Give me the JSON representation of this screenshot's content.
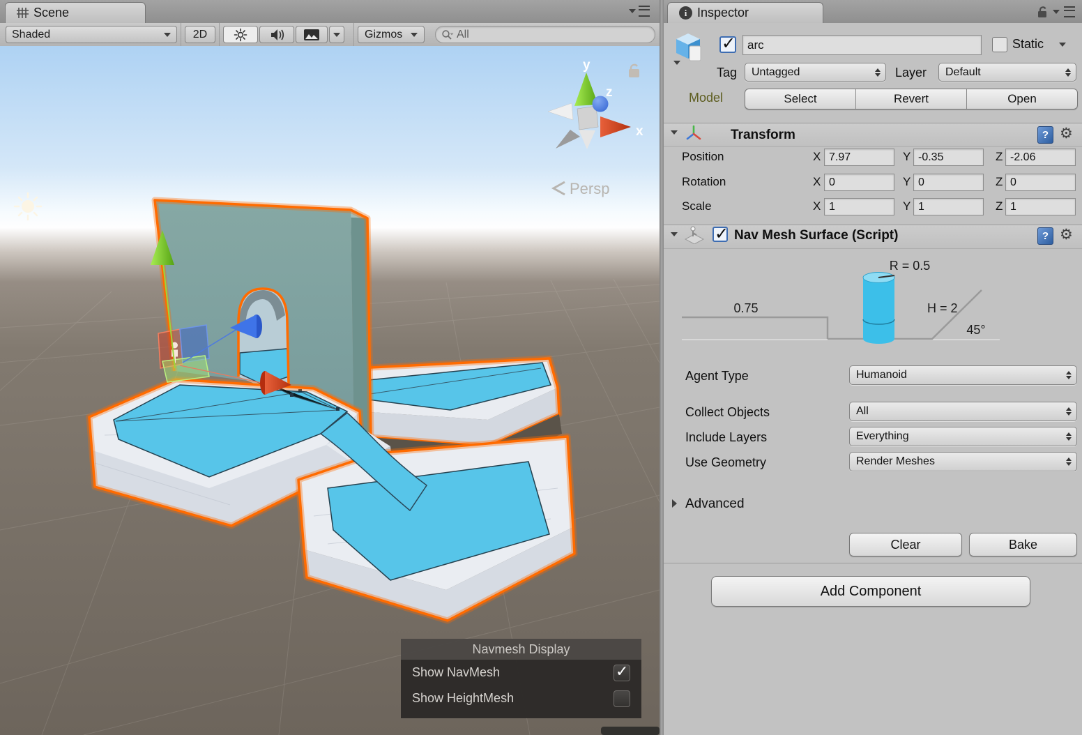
{
  "scene_panel": {
    "tab": "Scene",
    "toolbar": {
      "draw_mode": "Shaded",
      "mode_2d": "2D",
      "gizmos": "Gizmos",
      "search_value": "All"
    },
    "view": {
      "persp_label": "Persp",
      "axis": {
        "x": "x",
        "y": "y",
        "z": "z"
      }
    },
    "overlay": {
      "title": "Navmesh Display",
      "rows": [
        {
          "label": "Show NavMesh",
          "checked": true
        },
        {
          "label": "Show HeightMesh",
          "checked": false
        }
      ]
    }
  },
  "inspector": {
    "tab": "Inspector",
    "header": {
      "name": "arc",
      "static_label": "Static",
      "tag_label": "Tag",
      "tag_value": "Untagged",
      "layer_label": "Layer",
      "layer_value": "Default",
      "model_label": "Model",
      "model_buttons": [
        "Select",
        "Revert",
        "Open"
      ]
    },
    "transform": {
      "title": "Transform",
      "axis_labels": [
        "X",
        "Y",
        "Z"
      ],
      "rows": [
        {
          "label": "Position",
          "x": "7.97",
          "y": "-0.35",
          "z": "-2.06"
        },
        {
          "label": "Rotation",
          "x": "0",
          "y": "0",
          "z": "0"
        },
        {
          "label": "Scale",
          "x": "1",
          "y": "1",
          "z": "1"
        }
      ]
    },
    "navmesh": {
      "title": "Nav Mesh Surface (Script)",
      "diagram": {
        "radius": "R = 0.5",
        "step": "0.75",
        "height": "H = 2",
        "slope": "45°"
      },
      "fields": [
        {
          "label": "Agent Type",
          "value": "Humanoid"
        },
        {
          "label": "Collect Objects",
          "value": "All"
        },
        {
          "label": "Include Layers",
          "value": "Everything"
        },
        {
          "label": "Use Geometry",
          "value": "Render Meshes"
        }
      ],
      "advanced_label": "Advanced",
      "clear_label": "Clear",
      "bake_label": "Bake"
    },
    "add_component_label": "Add Component"
  },
  "colors": {
    "selection_orange": "#ff6b00",
    "navmesh_blue": "#57c5e9",
    "agent_cylinder_blue": "#3cbfe9"
  }
}
